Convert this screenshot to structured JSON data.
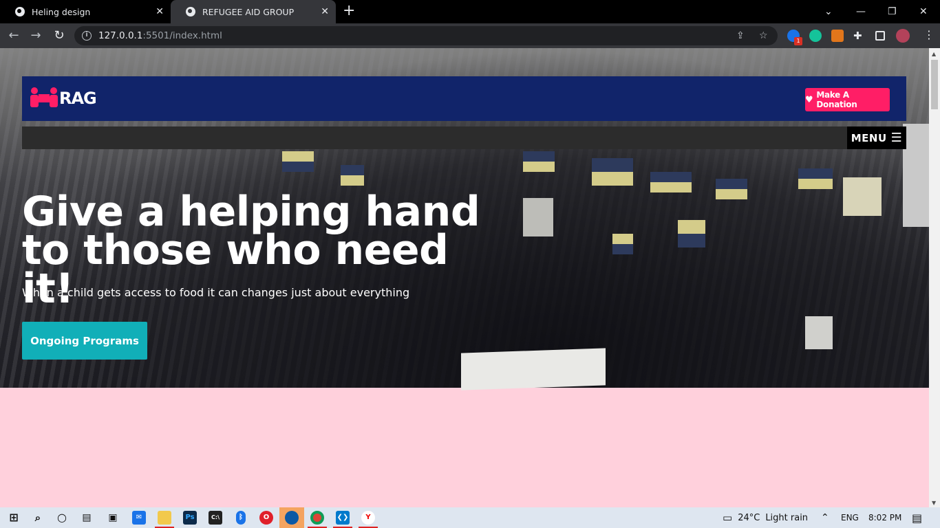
{
  "browser": {
    "tabs": [
      {
        "title": "Heling design",
        "active": false
      },
      {
        "title": "REFUGEE AID GROUP",
        "active": true
      }
    ],
    "url_host": "127.0.0.1",
    "url_rest": ":5501/index.html",
    "extension_badge": "1"
  },
  "site": {
    "logo_text": "RAG",
    "donate_label": "Make A Donation",
    "menu_label": "MENU",
    "hero_title": "Give a helping hand to those who need it!",
    "hero_subtitle": "When a child gets access to food it can changes just about everything",
    "cta_label": "Ongoing Programs"
  },
  "colors": {
    "header_bg": "#11246a",
    "accent_pink": "#ff1e66",
    "cta_teal": "#11afb8",
    "page_bg": "#ffd0dc",
    "menubar_bg": "#2c2c2c"
  },
  "taskbar": {
    "weather_temp": "24°C",
    "weather_text": "Light rain",
    "language": "ENG",
    "time": "8:02 PM"
  }
}
